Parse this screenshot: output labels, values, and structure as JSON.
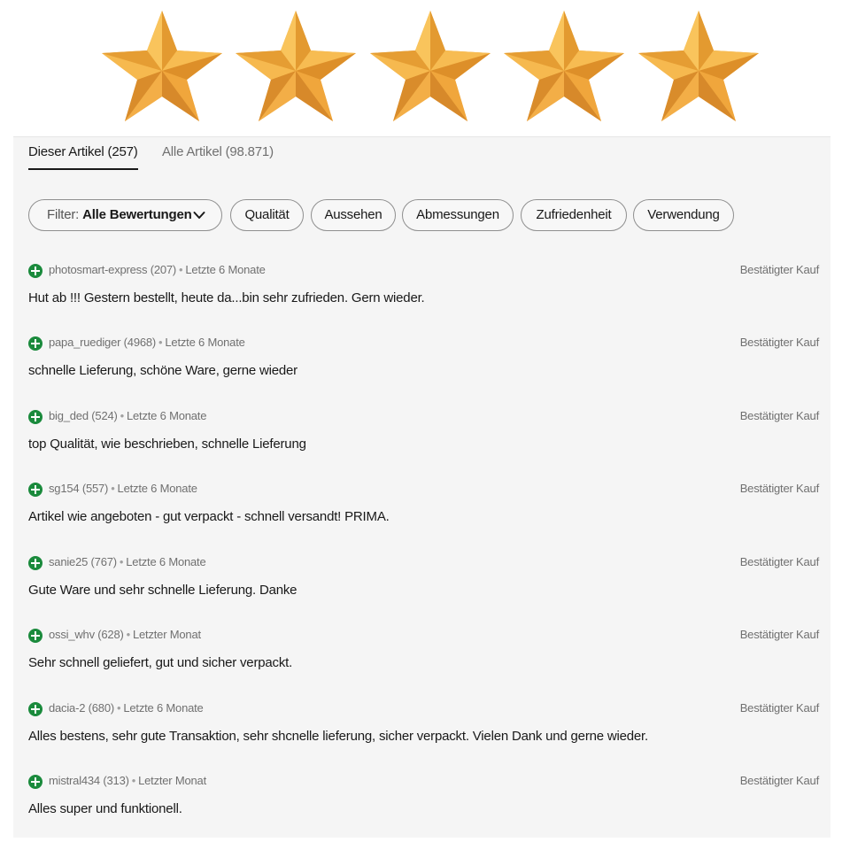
{
  "rating": {
    "stars": 5,
    "max": 5,
    "star_color": "#f2a93b"
  },
  "tabs": [
    {
      "label": "Dieser Artikel (257)",
      "active": true
    },
    {
      "label": "Alle Artikel (98.871)",
      "active": false
    }
  ],
  "filter": {
    "prefix": "Filter: ",
    "value": "Alle Bewertungen",
    "chips": [
      "Qualität",
      "Aussehen",
      "Abmessungen",
      "Zufriedenheit",
      "Verwendung"
    ]
  },
  "reviews": [
    {
      "user": "photosmart-express (207)",
      "time": "Letzte 6 Monate",
      "verified": "Bestätigter Kauf",
      "text": "Hut ab !!! Gestern bestellt, heute da...bin sehr zufrieden. Gern wieder."
    },
    {
      "user": "papa_ruediger (4968)",
      "time": "Letzte 6 Monate",
      "verified": "Bestätigter Kauf",
      "text": "schnelle Lieferung, schöne Ware, gerne wieder"
    },
    {
      "user": "big_ded (524)",
      "time": "Letzte 6 Monate",
      "verified": "Bestätigter Kauf",
      "text": "top Qualität, wie beschrieben, schnelle Lieferung"
    },
    {
      "user": "sg154 (557)",
      "time": "Letzte 6 Monate",
      "verified": "Bestätigter Kauf",
      "text": "Artikel wie angeboten - gut verpackt - schnell versandt! PRIMA."
    },
    {
      "user": "sanie25 (767)",
      "time": "Letzte 6 Monate",
      "verified": "Bestätigter Kauf",
      "text": "Gute Ware und sehr schnelle Lieferung. Danke"
    },
    {
      "user": "ossi_whv (628)",
      "time": "Letzter Monat",
      "verified": "Bestätigter Kauf",
      "text": "Sehr schnell geliefert, gut und sicher verpackt."
    },
    {
      "user": "dacia-2 (680)",
      "time": "Letzte 6 Monate",
      "verified": "Bestätigter Kauf",
      "text": "Alles bestens, sehr gute Transaktion, sehr shcnelle lieferung, sicher verpackt. Vielen Dank und gerne wieder."
    },
    {
      "user": "mistral434 (313)",
      "time": "Letzter Monat",
      "verified": "Bestätigter Kauf",
      "text": "Alles super und funktionell."
    }
  ],
  "colors": {
    "positive": "#1a8a3c",
    "panel_bg": "#f5f5f5",
    "muted_text": "#707070"
  }
}
